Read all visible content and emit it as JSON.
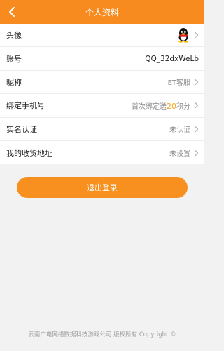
{
  "header": {
    "title": "个人资料"
  },
  "profile": {
    "rows": [
      {
        "label": "头像",
        "value": ""
      },
      {
        "label": "账号",
        "value": "QQ_32dxWeLb"
      },
      {
        "label": "昵称",
        "value": "ET客服"
      },
      {
        "label": "绑定手机号",
        "value_prefix": "首次绑定送",
        "value_highlight": "20",
        "value_suffix": "积分"
      },
      {
        "label": "实名认证",
        "value": "未认证"
      },
      {
        "label": "我的收货地址",
        "value": "未设置"
      }
    ]
  },
  "logout": {
    "label": "退出登录"
  },
  "footer": {
    "text": "云南广电网络数据科技游戏公司 版权所有 Copyright ©"
  },
  "colors": {
    "accent": "#f88b1f",
    "highlight": "#f5a623"
  }
}
